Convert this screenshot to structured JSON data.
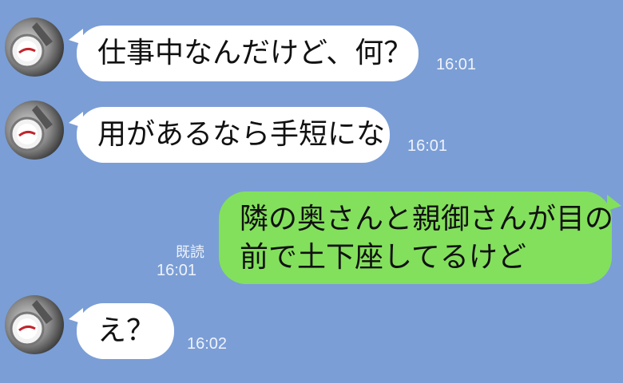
{
  "theme": {
    "background": "#7b9ed6",
    "incoming_bubble": "#ffffff",
    "outgoing_bubble": "#83e05c"
  },
  "messages": [
    {
      "direction": "incoming",
      "avatar_icon": "bottle-cap-avatar-icon",
      "text": "仕事中なんだけど、何？",
      "time": "16:01"
    },
    {
      "direction": "incoming",
      "avatar_icon": "bottle-cap-avatar-icon",
      "text": "用があるなら手短にな",
      "time": "16:01"
    },
    {
      "direction": "outgoing",
      "text_line1": "隣の奥さんと親御さんが目の",
      "text_line2": "前で土下座してるけど",
      "read_label": "既読",
      "time": "16:01"
    },
    {
      "direction": "incoming",
      "avatar_icon": "bottle-cap-avatar-icon",
      "text": "え？",
      "time": "16:02"
    }
  ]
}
